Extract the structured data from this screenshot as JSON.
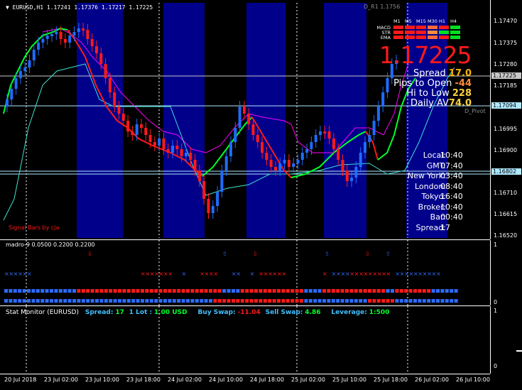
{
  "chart": {
    "title": "EURUSD,H1  1.17241 1.17376 1.17217 1.17225",
    "big_price": "1.17225",
    "r1_label": "D_R1 1.1756",
    "pivot_label": "D_Pivot",
    "signal_label": "Signal Bars by cja",
    "price_ticks": [
      "1.17470",
      "1.17375",
      "1.17280",
      "1.17185",
      "1.16995",
      "1.16900",
      "1.16710",
      "1.16615",
      "1.16520"
    ],
    "highlight_ticks": {
      "current": "1.17225",
      "pivot": "1.17094",
      "support": "1.16802"
    }
  },
  "stats": {
    "spread_label": "Spread",
    "spread_value": "17.0",
    "pips_label": "Pips to Open",
    "pips_value": "-44",
    "hilo_label": "Hi to Low",
    "hilo_value": "228",
    "daily_label": "Daily AV",
    "daily_value": "74.0"
  },
  "mtf": {
    "timeframes": [
      "M1",
      "M5",
      "M15",
      "M30",
      "H1",
      "H4"
    ],
    "rows": [
      "MACD",
      "STR",
      "EMA"
    ]
  },
  "clock": [
    {
      "label": "Local:",
      "value": "10:40"
    },
    {
      "label": "GMT:",
      "value": "07:40"
    },
    {
      "label": "New York:",
      "value": "03:40"
    },
    {
      "label": "London:",
      "value": "08:40"
    },
    {
      "label": "Tokyo:",
      "value": "16:40"
    },
    {
      "label": "Broker:",
      "value": "10:40"
    },
    {
      "label": "Bar:",
      "value": "00:40"
    },
    {
      "label": "Spread:",
      "value": "17"
    }
  ],
  "madro": {
    "title": "madro-9 0.0500 0.2200 0.2200",
    "scale_top": "1",
    "scale_bottom": "0"
  },
  "stat_monitor": {
    "title": "Stat Monitor (EURUSD)",
    "spread_label": "Spread:",
    "spread_value": "17",
    "lot_label": "1 Lot :",
    "lot_value": "1.00 USD",
    "buy_label": "Buy Swap:",
    "buy_value": "-11.04",
    "sell_label": "Sell Swap:",
    "sell_value": "4.86",
    "lev_label": "Leverage:",
    "lev_value": "1:500",
    "scale_top": "1",
    "scale_bottom": "0"
  },
  "time_axis": [
    "20 Jul 2018",
    "23 Jul 02:00",
    "23 Jul 10:00",
    "23 Jul 18:00",
    "24 Jul 02:00",
    "24 Jul 10:00",
    "24 Jul 18:00",
    "25 Jul 02:00",
    "25 Jul 10:00",
    "25 Jul 18:00",
    "26 Jul 02:00",
    "26 Jul 10:00"
  ],
  "colors": {
    "up": "#1e6cff",
    "down": "#ff1a1a",
    "ema": "#00ff2a",
    "band": "#00008b",
    "pivot": "#aee8ff",
    "magenta": "#ff00ff",
    "cyan": "#40e0d0"
  }
}
